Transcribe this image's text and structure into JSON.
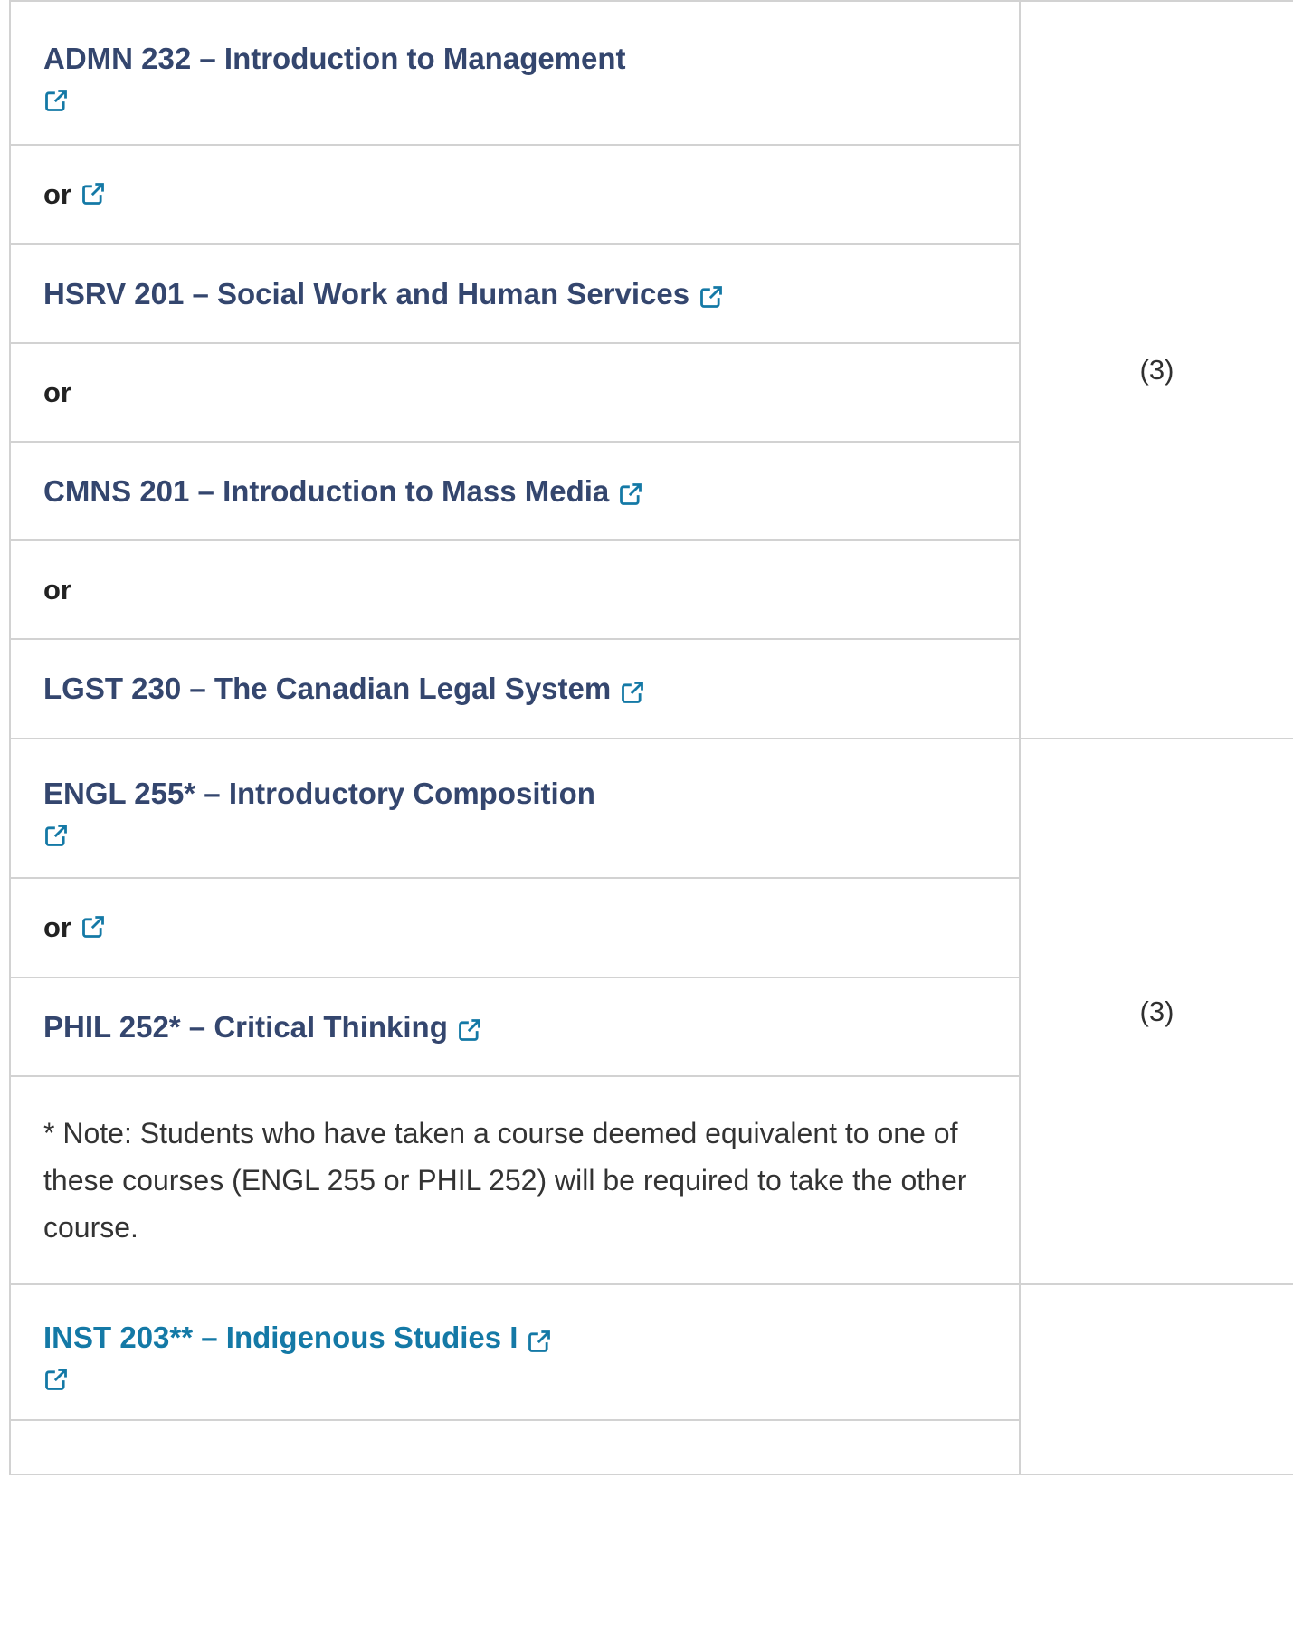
{
  "group1": {
    "credits": "(3)",
    "rows": [
      {
        "type": "course",
        "text": "ADMN 232 – Introduction to Management"
      },
      {
        "type": "or",
        "text": "or"
      },
      {
        "type": "course",
        "text": "HSRV 201 – Social Work and Human Services"
      },
      {
        "type": "or",
        "text": "or"
      },
      {
        "type": "course",
        "text": "CMNS 201 – Introduction to Mass Media"
      },
      {
        "type": "or",
        "text": "or"
      },
      {
        "type": "course",
        "text": "LGST 230 – The Canadian Legal System"
      }
    ]
  },
  "group2": {
    "credits": "(3)",
    "rows": [
      {
        "type": "course",
        "text": "ENGL 255* – Introductory Composition"
      },
      {
        "type": "or",
        "text": "or"
      },
      {
        "type": "course",
        "text": "PHIL 252* – Critical Thinking"
      },
      {
        "type": "note",
        "text": "* Note: Students who have taken a course deemed equivalent to one of these courses (ENGL 255 or PHIL 252) will be required to take the other course."
      }
    ]
  },
  "group3": {
    "credits": "",
    "rows": [
      {
        "type": "course",
        "text": "INST 203** – Indigenous Studies I"
      }
    ]
  },
  "icons": {
    "external_link": "external-link-icon",
    "color": "#1479a6"
  }
}
